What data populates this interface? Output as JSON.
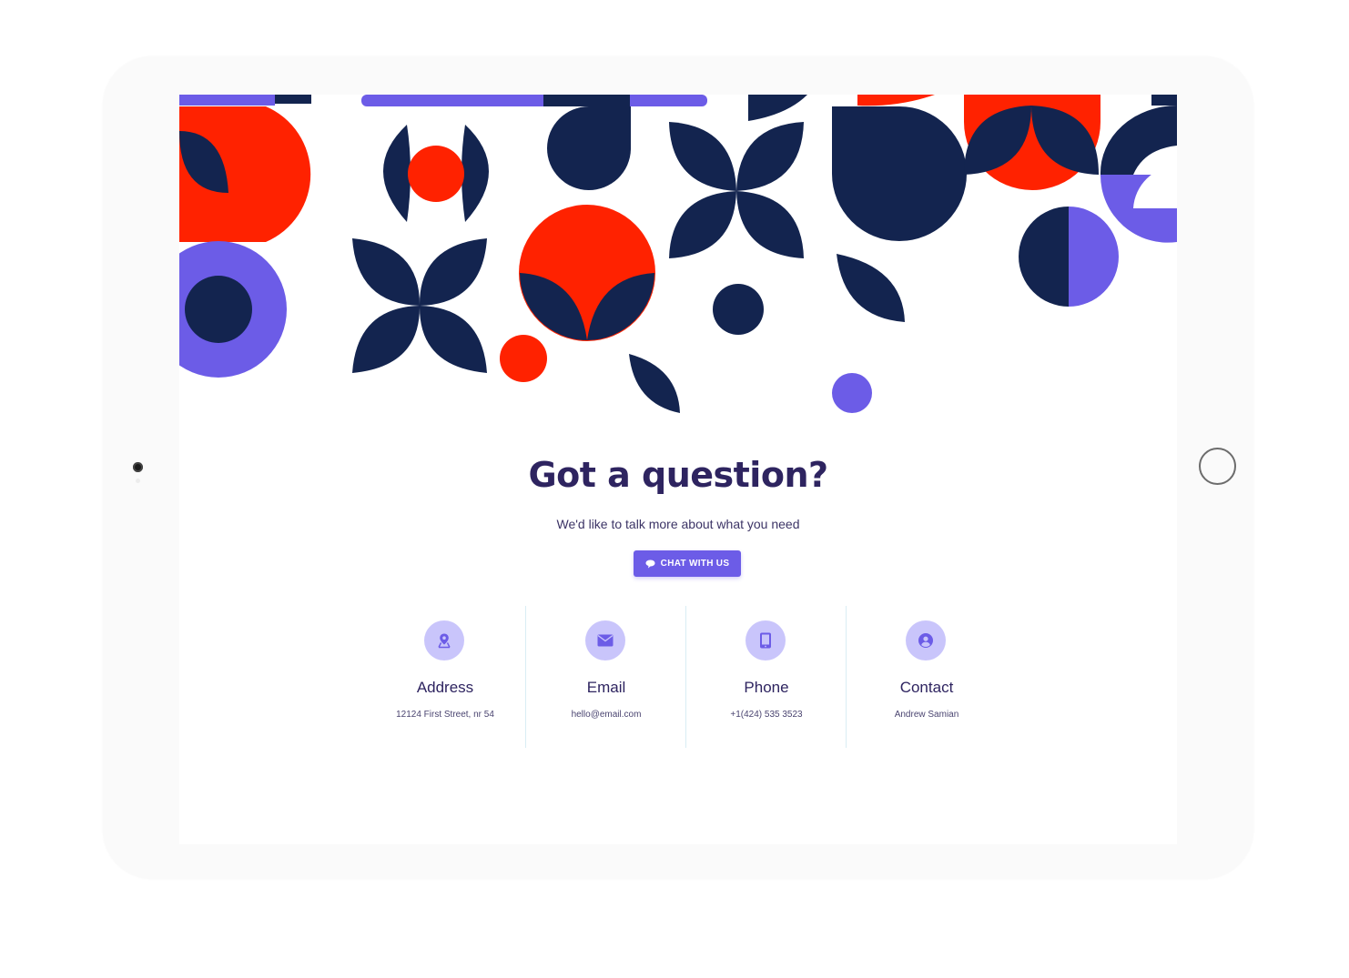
{
  "contact_section": {
    "headline": "Got a question?",
    "subline": "We'd like to talk more about what you need",
    "chat_button_label": "CHAT WITH US"
  },
  "info_items": [
    {
      "title": "Address",
      "value": "12124 First Street, nr 54",
      "icon": "map-pin-icon"
    },
    {
      "title": "Email",
      "value": "hello@email.com",
      "icon": "envelope-icon"
    },
    {
      "title": "Phone",
      "value": "+1(424) 535 3523",
      "icon": "tablet-icon"
    },
    {
      "title": "Contact",
      "value": "Andrew Samian",
      "icon": "user-icon"
    }
  ],
  "colors": {
    "navy": "#13244f",
    "red": "#ff2200",
    "purple": "#6c5ce7",
    "icon_bg": "#c9c5fb",
    "heading": "#2e2460"
  }
}
